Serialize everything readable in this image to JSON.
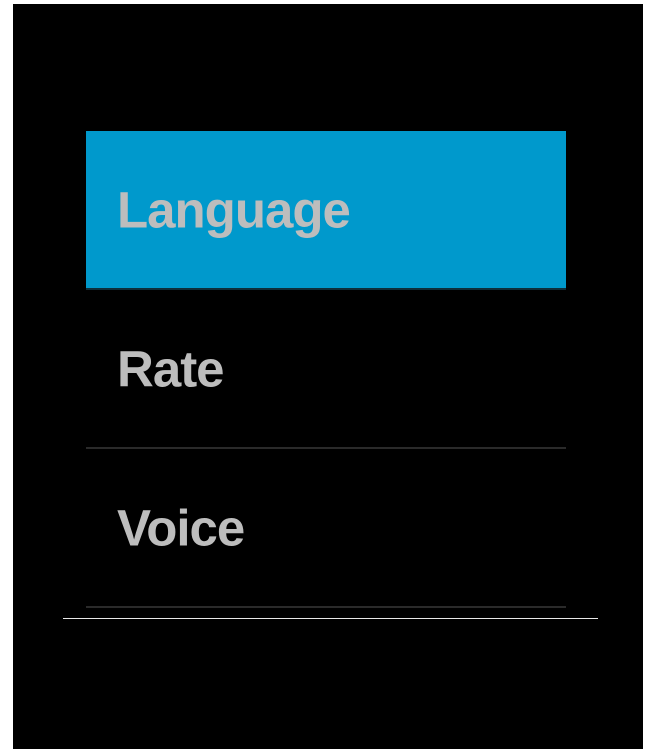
{
  "colors": {
    "screen_background": "#000000",
    "selected_background": "#0099cc",
    "label_text": "#bdbdbd",
    "divider": "#2a2a2a"
  },
  "menu": {
    "selected_index": 0,
    "items": [
      {
        "label": "Language"
      },
      {
        "label": "Rate"
      },
      {
        "label": "Voice"
      }
    ]
  }
}
